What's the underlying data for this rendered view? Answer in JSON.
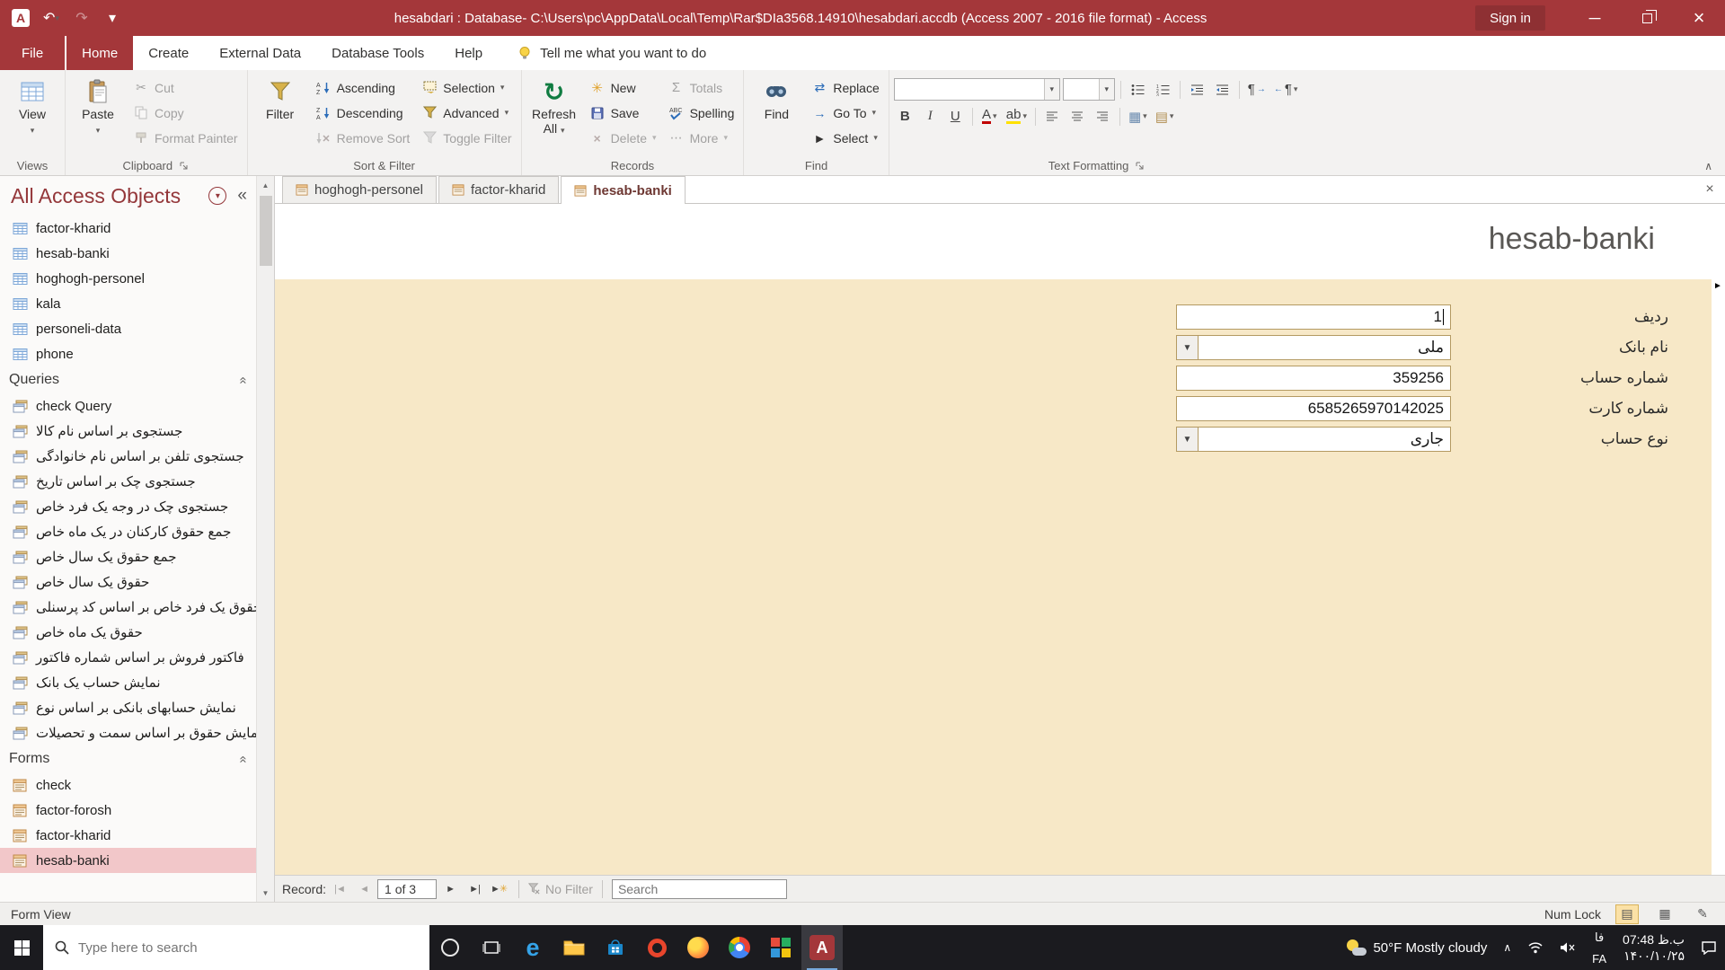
{
  "titlebar": {
    "title": "hesabdari : Database- C:\\Users\\pc\\AppData\\Local\\Temp\\Rar$DIa3568.14910\\hesabdari.accdb (Access 2007 - 2016 file format)  -  Access",
    "sign_in": "Sign in"
  },
  "ribbon": {
    "tabs": {
      "file": "File",
      "home": "Home",
      "create": "Create",
      "external_data": "External Data",
      "database_tools": "Database Tools",
      "help": "Help"
    },
    "tell_me": "Tell me what you want to do",
    "views": {
      "label": "Views",
      "view": "View"
    },
    "clipboard": {
      "label": "Clipboard",
      "paste": "Paste",
      "cut": "Cut",
      "copy": "Copy",
      "format_painter": "Format Painter"
    },
    "sort_filter": {
      "label": "Sort & Filter",
      "filter": "Filter",
      "ascending": "Ascending",
      "descending": "Descending",
      "remove_sort": "Remove Sort",
      "selection": "Selection",
      "advanced": "Advanced",
      "toggle_filter": "Toggle Filter"
    },
    "records": {
      "label": "Records",
      "refresh_all": "Refresh All",
      "new": "New",
      "save": "Save",
      "delete": "Delete",
      "totals": "Totals",
      "spelling": "Spelling",
      "more": "More"
    },
    "find_group": {
      "label": "Find",
      "find": "Find",
      "replace": "Replace",
      "go_to": "Go To",
      "select": "Select"
    },
    "text_formatting": {
      "label": "Text Formatting",
      "bold": "B",
      "italic": "I",
      "underline": "U"
    }
  },
  "sidebar": {
    "header": "All Access Objects",
    "tables": [
      "factor-kharid",
      "hesab-banki",
      "hoghogh-personel",
      "kala",
      "personeli-data",
      "phone"
    ],
    "queries_header": "Queries",
    "queries": [
      "check Query",
      "جستجوی بر اساس نام کالا",
      "جستجوی تلفن بر اساس نام خانوادگی",
      "جستجوی چک بر اساس تاریخ",
      "جستجوی چک در وجه یک فرد خاص",
      "جمع حقوق کارکنان در یک ماه خاص",
      "جمع حقوق یک سال خاص",
      "حقوق یک سال خاص",
      "حقوق یک فرد خاص بر اساس کد پرسنلی",
      "حقوق یک ماه خاص",
      "فاکتور فروش بر اساس شماره فاکتور",
      "نمایش حساب یک بانک",
      "نمایش حسابهای بانکی بر اساس نوع",
      "نمایش حقوق بر اساس سمت و تحصیلات"
    ],
    "forms_header": "Forms",
    "forms": [
      {
        "label": "check"
      },
      {
        "label": "factor-forosh"
      },
      {
        "label": "factor-kharid"
      },
      {
        "label": "hesab-banki",
        "selected": true
      }
    ]
  },
  "doc_tabs": [
    "hoghogh-personel",
    "factor-kharid",
    "hesab-banki"
  ],
  "form": {
    "title": "hesab-banki",
    "fields": [
      {
        "label": "ردیف",
        "value": "1",
        "type": "text"
      },
      {
        "label": "نام بانک",
        "value": "ملی",
        "type": "combo"
      },
      {
        "label": "شماره حساب",
        "value": "359256",
        "type": "text"
      },
      {
        "label": "شماره کارت",
        "value": "6585265970142025",
        "type": "text"
      },
      {
        "label": "نوع حساب",
        "value": "جاری",
        "type": "combo"
      }
    ]
  },
  "record_nav": {
    "record_label": "Record:",
    "position": "1 of 3",
    "no_filter": "No Filter",
    "search": "Search"
  },
  "status_bar": {
    "view_label": "Form View",
    "num_lock": "Num Lock"
  },
  "taskbar": {
    "search_placeholder": "Type here to search",
    "weather": "50°F Mostly cloudy",
    "lang_line1": "فا",
    "lang_line2": "FA",
    "time": "07:48 ب.ظ",
    "date": "۱۴۰۰/۱۰/۲۵"
  }
}
